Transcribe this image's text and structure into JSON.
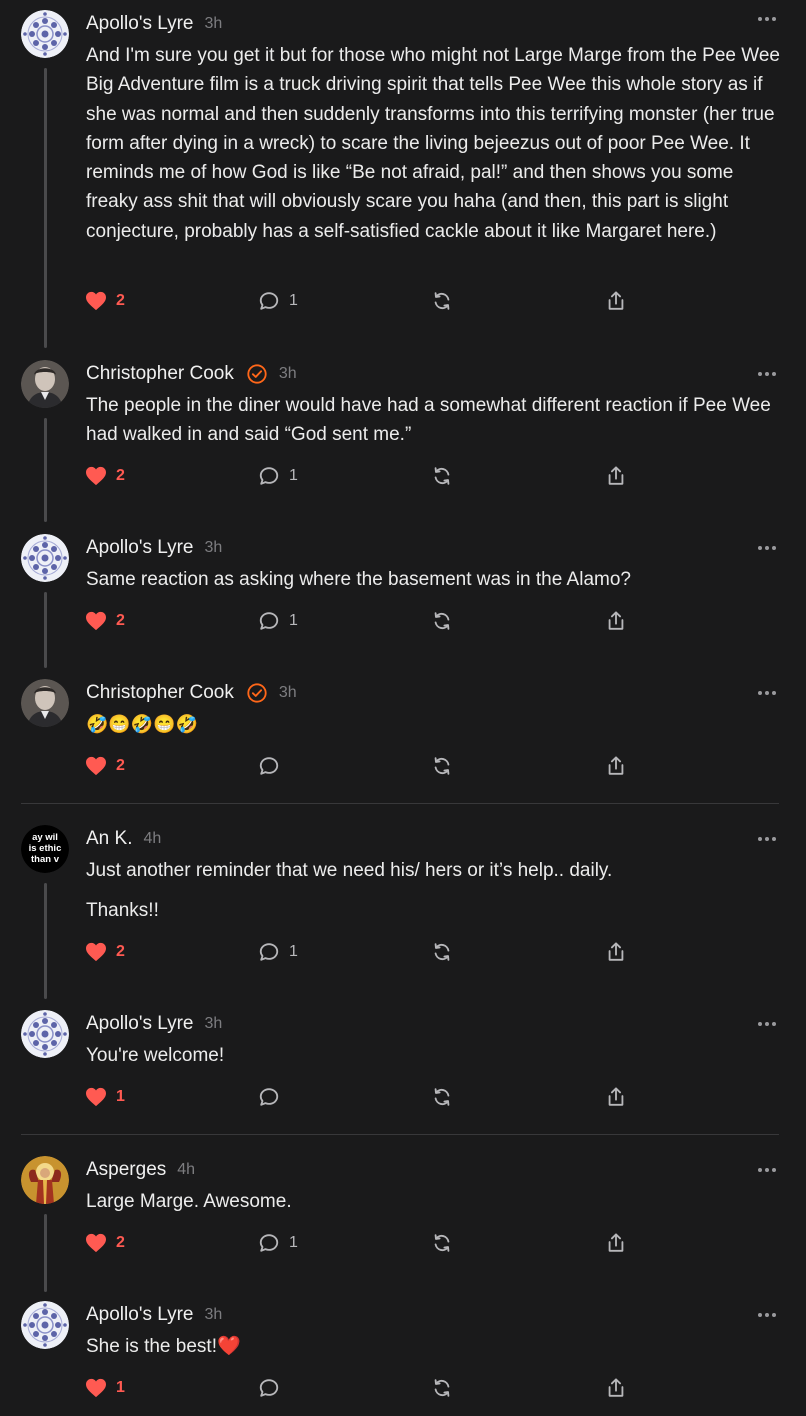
{
  "comments": [
    {
      "author": "Apollo's Lyre",
      "time": "3h",
      "avatar": "mandala-avatar",
      "verified": false,
      "paragraphs": [
        "And I'm sure you get it but for those who might not Large Marge from the Pee Wee Big Adventure film is a truck driving spirit that tells Pee Wee this whole story as if she was normal and then suddenly transforms into this terrifying monster (her true form after dying in a wreck) to scare the living bejeezus out of poor Pee Wee. It reminds me of how God is like “Be not afraid, pal!” and then shows you some freaky ass shit that will obviously scare you haha (and then, this part is slight conjecture, probably has a self-satisfied cackle about it like Margaret here.)"
      ],
      "likes": "2",
      "replies": "1"
    },
    {
      "author": "Christopher Cook",
      "time": "3h",
      "avatar": "photo-avatar",
      "verified": true,
      "paragraphs": [
        "The people in the diner would have had a somewhat different reaction if Pee Wee had walked in and said “God sent me.”"
      ],
      "likes": "2",
      "replies": "1"
    },
    {
      "author": "Apollo's Lyre",
      "time": "3h",
      "avatar": "mandala-avatar",
      "verified": false,
      "paragraphs": [
        "Same reaction as asking where the basement was in the Alamo?"
      ],
      "likes": "2",
      "replies": "1"
    },
    {
      "author": "Christopher Cook",
      "time": "3h",
      "avatar": "photo-avatar",
      "verified": true,
      "paragraphs": [
        "🤣😁🤣😁🤣"
      ],
      "likes": "2",
      "replies": ""
    },
    {
      "author": "An K.",
      "time": "4h",
      "avatar": "text-avatar",
      "avatar_text": [
        "ay wil",
        "is ethic",
        "than v"
      ],
      "verified": false,
      "paragraphs": [
        "Just another reminder that we need his/ hers or it’s help.. daily.",
        "Thanks!!"
      ],
      "likes": "2",
      "replies": "1"
    },
    {
      "author": "Apollo's Lyre",
      "time": "3h",
      "avatar": "mandala-avatar",
      "verified": false,
      "paragraphs": [
        "You're welcome!"
      ],
      "likes": "1",
      "replies": ""
    },
    {
      "author": "Asperges",
      "time": "4h",
      "avatar": "icon-avatar",
      "verified": false,
      "paragraphs": [
        "Large Marge. Awesome."
      ],
      "likes": "2",
      "replies": "1"
    },
    {
      "author": "Apollo's Lyre",
      "time": "3h",
      "avatar": "mandala-avatar",
      "verified": false,
      "paragraphs": [
        "She is the best!❤️"
      ],
      "likes": "1",
      "replies": ""
    }
  ],
  "colors": {
    "background": "#1a1a1b",
    "like": "#ff5a52",
    "verified": "#ff6719",
    "muted": "#7d7d80"
  }
}
